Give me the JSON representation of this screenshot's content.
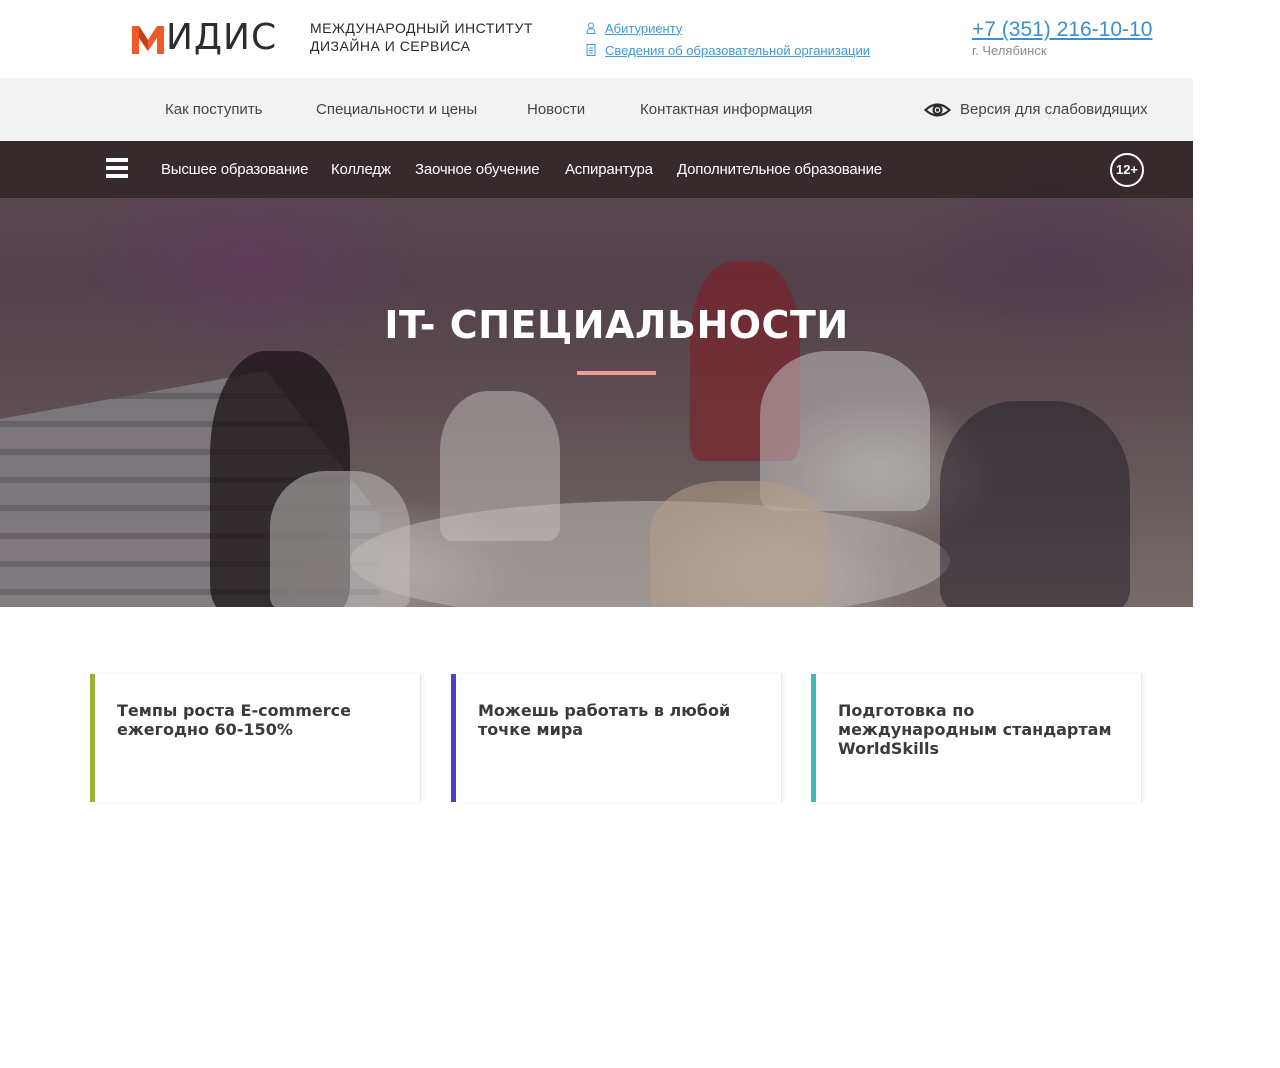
{
  "colors": {
    "brand_orange": "#f05a28",
    "link_blue": "#3c9bd6",
    "card_bar_1": "#9bb333",
    "card_bar_2": "#4b3fd0",
    "card_bar_3": "#3fb9bd",
    "hero_underline": "#f29b9b"
  },
  "header": {
    "logo_text": "ИДИС",
    "logo_sub_line1": "Международный институт",
    "logo_sub_line2": "дизайна и сервиса",
    "links": [
      {
        "label": "Абитуриенту",
        "icon": "user-icon"
      },
      {
        "label": "Сведения об образовательной организации",
        "icon": "document-icon"
      }
    ],
    "phone": "+7 (351) 216-10-10",
    "city": "г. Челябинск"
  },
  "nav": {
    "items": [
      {
        "label": "Как поступить"
      },
      {
        "label": "Специальности и цены"
      },
      {
        "label": "Новости"
      },
      {
        "label": "Контактная информация"
      }
    ],
    "vision_label": "Версия для слабовидящих"
  },
  "hero": {
    "subnav": [
      {
        "label": "Высшее образование"
      },
      {
        "label": "Колледж"
      },
      {
        "label": "Заочное обучение"
      },
      {
        "label": "Аспирантура"
      },
      {
        "label": "Дополнительное образование"
      }
    ],
    "age_badge": "12+",
    "title": "IT- СПЕЦИАЛЬНОСТИ"
  },
  "cards": [
    {
      "text": "Темпы роста E-commerce ежегодно 60-150%"
    },
    {
      "text": "Можешь работать в любой точке мира"
    },
    {
      "text": "Подготовка по международным стандартам WorldSkills"
    }
  ]
}
